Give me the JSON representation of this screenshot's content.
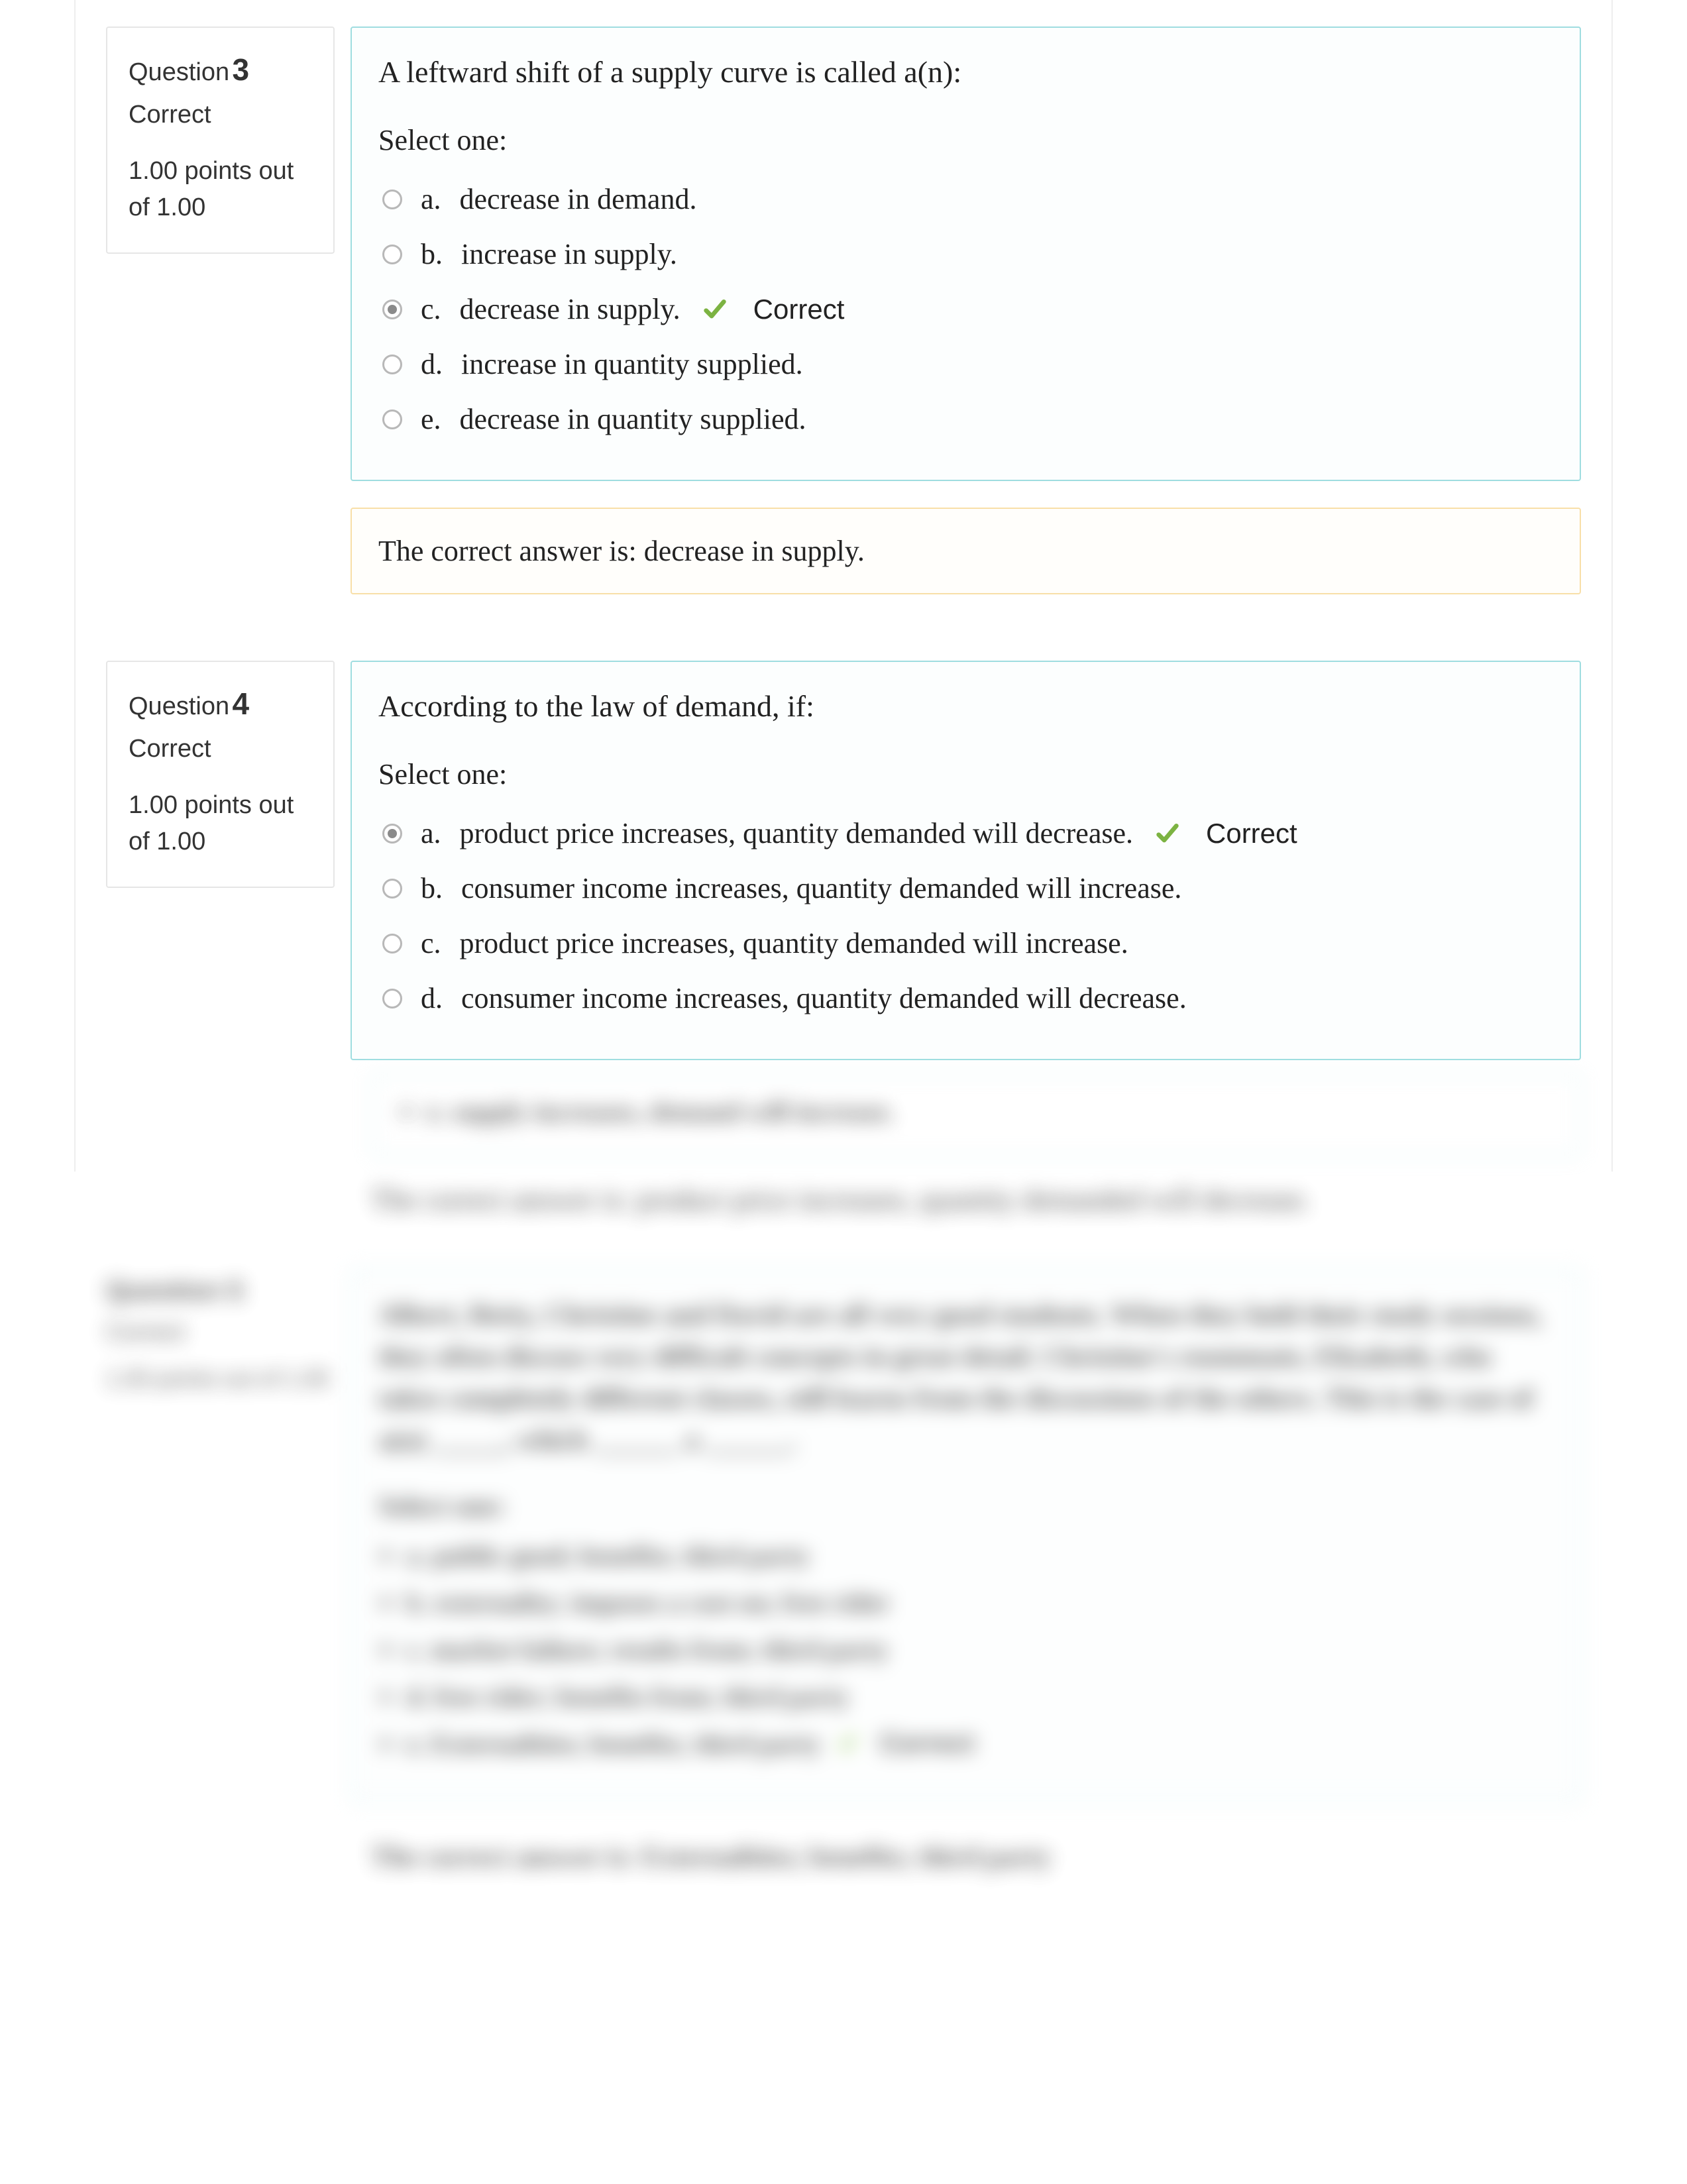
{
  "labels": {
    "question_prefix": "Question",
    "select_one": "Select one:",
    "correct_mark": "Correct",
    "answer_prefix": "The correct answer is:"
  },
  "questions": [
    {
      "number": "3",
      "status": "Correct",
      "points_text": "1.00 points out of 1.00",
      "prompt": "A leftward shift of a supply curve is called a(n):",
      "options": [
        {
          "letter": "a.",
          "text": "decrease in demand.",
          "selected": false,
          "correct": false
        },
        {
          "letter": "b.",
          "text": "increase in supply.",
          "selected": false,
          "correct": false
        },
        {
          "letter": "c.",
          "text": "decrease in supply.",
          "selected": true,
          "correct": true
        },
        {
          "letter": "d.",
          "text": "increase in quantity supplied.",
          "selected": false,
          "correct": false
        },
        {
          "letter": "e.",
          "text": "decrease in quantity supplied.",
          "selected": false,
          "correct": false
        }
      ],
      "answer_text": "decrease in supply."
    },
    {
      "number": "4",
      "status": "Correct",
      "points_text": "1.00 points out of 1.00",
      "prompt": "According to the law of demand, if:",
      "options": [
        {
          "letter": "a.",
          "text": "product price increases, quantity demanded will decrease.",
          "selected": true,
          "correct": true
        },
        {
          "letter": "b.",
          "text": "consumer income increases, quantity demanded will increase.",
          "selected": false,
          "correct": false
        },
        {
          "letter": "c.",
          "text": "product price increases, quantity demanded will increase.",
          "selected": false,
          "correct": false
        },
        {
          "letter": "d.",
          "text": "consumer income increases, quantity demanded will decrease.",
          "selected": false,
          "correct": false
        }
      ],
      "answer_text": ""
    }
  ]
}
